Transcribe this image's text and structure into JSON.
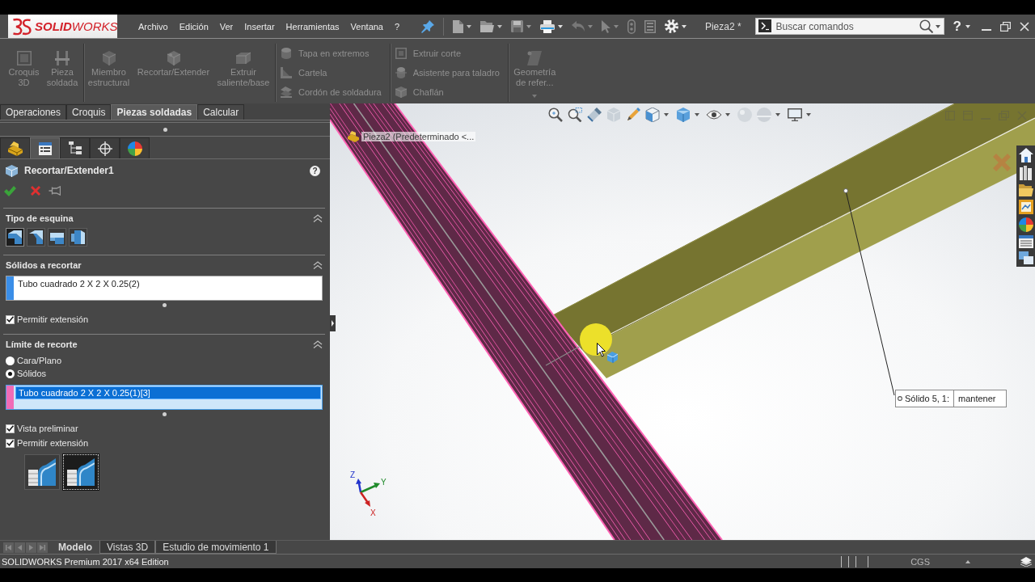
{
  "menu_bar": {
    "logo": "**SOLID**WORKS",
    "menus": [
      "Archivo",
      "Edición",
      "Ver",
      "Insertar",
      "Herramientas",
      "Ventana",
      "?"
    ],
    "document_title": "Pieza2 *",
    "search": {
      "placeholder": "Buscar comandos"
    },
    "help_glyph": "?"
  },
  "ribbon": {
    "groups": [
      {
        "kind": "large",
        "items": [
          {
            "label": "Croquis 3D",
            "disabled": true
          },
          {
            "label": "Pieza soldada",
            "disabled": true
          }
        ]
      },
      {
        "kind": "large",
        "items": [
          {
            "label": "Miembro estructural",
            "disabled": true
          },
          {
            "label": "Recortar/Extender",
            "disabled": true
          },
          {
            "label": "Extruir saliente/base",
            "disabled": true
          }
        ]
      },
      {
        "kind": "small",
        "items": [
          {
            "label": "Tapa en extremos",
            "disabled": true
          },
          {
            "label": "Cartela",
            "disabled": true
          },
          {
            "label": "Cordón de soldadura",
            "disabled": true
          }
        ]
      },
      {
        "kind": "small",
        "items": [
          {
            "label": "Extruir corte",
            "disabled": true
          },
          {
            "label": "Asistente para taladro",
            "disabled": true
          },
          {
            "label": "Chaflán",
            "disabled": true
          }
        ]
      },
      {
        "kind": "menu",
        "items": [
          {
            "label": "Geometría de refer...",
            "disabled": true
          }
        ]
      }
    ]
  },
  "command_tabs": [
    {
      "label": "Operaciones",
      "selected": false
    },
    {
      "label": "Croquis",
      "selected": false
    },
    {
      "label": "Piezas soldadas",
      "selected": true
    },
    {
      "label": "Calcular",
      "selected": false
    }
  ],
  "panel_tabs": [
    {
      "selected": false
    },
    {
      "selected": true
    },
    {
      "selected": false
    },
    {
      "selected": false
    },
    {
      "selected": false
    }
  ],
  "property_manager": {
    "title": "Recortar/Extender1",
    "help_glyph": "?",
    "sections": [
      {
        "title": "Tipo de esquina",
        "expanded": true,
        "corner_types": [
          {
            "selected": true
          },
          {
            "selected": false
          },
          {
            "selected": false
          },
          {
            "selected": false
          }
        ]
      },
      {
        "title": "Sólidos a recortar",
        "expanded": true,
        "list": {
          "color": "#3a8ee8",
          "focused": false,
          "items": [
            {
              "label": "Tubo cuadrado 2 X 2 X 0.25(2)",
              "selected": false
            }
          ]
        },
        "checkboxes": [
          {
            "label": "Permitir extensión",
            "checked": true
          }
        ]
      },
      {
        "title": "Límite de recorte",
        "expanded": true,
        "radios": [
          {
            "label": "Cara/Plano",
            "selected": false
          },
          {
            "label": "Sólidos",
            "selected": true
          }
        ],
        "list": {
          "color": "#f06cb6",
          "focused": true,
          "items": [
            {
              "label": "Tubo cuadrado 2 X 2 X 0.25(1)[3]",
              "selected": true
            }
          ]
        },
        "checkboxes": [
          {
            "label": "Vista preliminar",
            "checked": true
          },
          {
            "label": "Permitir extensión",
            "checked": true
          }
        ],
        "trim_types": [
          {
            "selected": false
          },
          {
            "selected": true
          }
        ]
      }
    ]
  },
  "viewport": {
    "tree_item": "Pieza2 (Predeterminado <...",
    "callout": {
      "label": "Sólido 5, 1:",
      "action": "mantener"
    },
    "triad": {
      "x": "X",
      "y": "Y",
      "z": "Z"
    }
  },
  "bottom_tabs": [
    {
      "label": "Modelo",
      "selected": true
    },
    {
      "label": "Vistas 3D",
      "selected": false
    },
    {
      "label": "Estudio de movimiento 1",
      "selected": false
    }
  ],
  "status_bar": {
    "edition": "SOLIDWORKS Premium 2017 x64 Edition",
    "units": "CGS"
  }
}
